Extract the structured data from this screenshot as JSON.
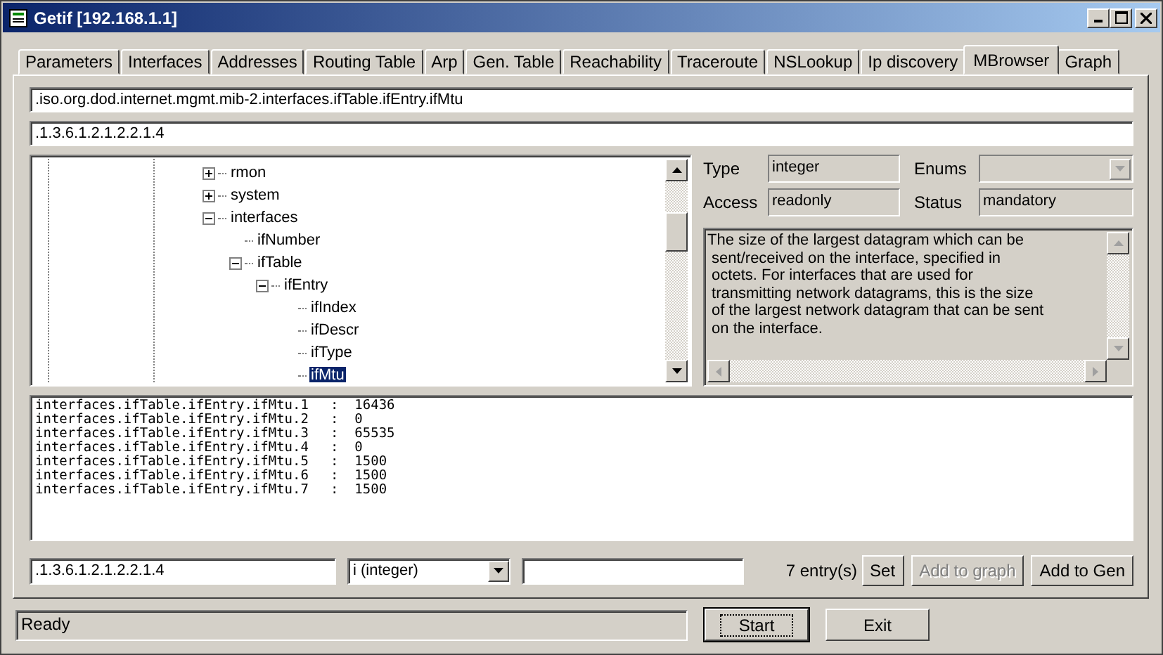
{
  "window": {
    "title": "Getif [192.168.1.1]"
  },
  "tabs": [
    {
      "label": "Parameters",
      "selected": false
    },
    {
      "label": "Interfaces",
      "selected": false
    },
    {
      "label": "Addresses",
      "selected": false
    },
    {
      "label": "Routing Table",
      "selected": false
    },
    {
      "label": "Arp",
      "selected": false
    },
    {
      "label": "Gen. Table",
      "selected": false
    },
    {
      "label": "Reachability",
      "selected": false
    },
    {
      "label": "Traceroute",
      "selected": false
    },
    {
      "label": "NSLookup",
      "selected": false
    },
    {
      "label": "Ip discovery",
      "selected": false
    },
    {
      "label": "MBrowser",
      "selected": true
    },
    {
      "label": "Graph",
      "selected": false
    }
  ],
  "oid_name": ".iso.org.dod.internet.mgmt.mib-2.interfaces.ifTable.ifEntry.ifMtu",
  "oid_number": ".1.3.6.1.2.1.2.2.1.4",
  "tree": [
    {
      "label": "rmon",
      "expanded": false,
      "selected": false
    },
    {
      "label": "system",
      "expanded": false,
      "selected": false
    },
    {
      "label": "interfaces",
      "expanded": true,
      "selected": false,
      "children": [
        {
          "label": "ifNumber",
          "selected": false
        },
        {
          "label": "ifTable",
          "expanded": true,
          "selected": false,
          "children": [
            {
              "label": "ifEntry",
              "expanded": true,
              "selected": false,
              "children": [
                {
                  "label": "ifIndex",
                  "selected": false
                },
                {
                  "label": "ifDescr",
                  "selected": false
                },
                {
                  "label": "ifType",
                  "selected": false
                },
                {
                  "label": "ifMtu",
                  "selected": true
                }
              ]
            }
          ]
        }
      ]
    }
  ],
  "details": {
    "type_label": "Type",
    "type_value": "integer",
    "enums_label": "Enums",
    "access_label": "Access",
    "access_value": "readonly",
    "status_label": "Status",
    "status_value": "mandatory",
    "description": "The size of the largest datagram which can be\n sent/received on the interface, specified in\n octets. For interfaces that are used for\n transmitting network datagrams, this is the size\n of the largest network datagram that can be sent\n on the interface."
  },
  "results": [
    {
      "name": "interfaces.ifTable.ifEntry.ifMtu.1",
      "value": ":  16436"
    },
    {
      "name": "interfaces.ifTable.ifEntry.ifMtu.2",
      "value": ":  0"
    },
    {
      "name": "interfaces.ifTable.ifEntry.ifMtu.3",
      "value": ":  65535"
    },
    {
      "name": "interfaces.ifTable.ifEntry.ifMtu.4",
      "value": ":  0"
    },
    {
      "name": "interfaces.ifTable.ifEntry.ifMtu.5",
      "value": ":  1500"
    },
    {
      "name": "interfaces.ifTable.ifEntry.ifMtu.6",
      "value": ":  1500"
    },
    {
      "name": "interfaces.ifTable.ifEntry.ifMtu.7",
      "value": ":  1500"
    }
  ],
  "set_bar": {
    "oid": ".1.3.6.1.2.1.2.2.1.4",
    "value_type": "i (integer)",
    "entry_count": "7 entry(s)"
  },
  "actions": [
    {
      "label": "Set",
      "disabled": false
    },
    {
      "label": "Add to graph",
      "disabled": true
    },
    {
      "label": "Add to Gen",
      "disabled": false
    }
  ],
  "status_bar": "Ready",
  "footer_buttons": [
    {
      "label": "Start",
      "focused": true
    },
    {
      "label": "Exit",
      "focused": false
    }
  ]
}
